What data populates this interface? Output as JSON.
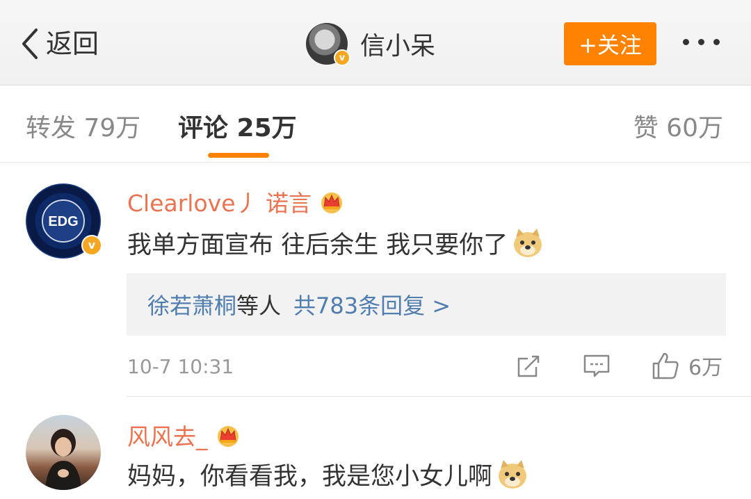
{
  "header": {
    "back_label": "返回",
    "title": "信小呆",
    "follow_label": "+关注"
  },
  "tabs": {
    "forward": "转发 79万",
    "comment": "评论 25万",
    "like": "赞 60万"
  },
  "comments": [
    {
      "username": "Clearlove丿 诺言",
      "avatar_text": "EDG",
      "text": "我单方面宣布 往后余生 我只要你了",
      "replies": {
        "name": "徐若萧桐",
        "middle": "等人",
        "count": "共783条回复 >"
      },
      "time": "10-7 10:31",
      "like_count": "6万"
    },
    {
      "username": "风风去_",
      "text": "妈妈，你看看我，我是您小女儿啊"
    }
  ],
  "colors": {
    "accent": "#ff8200",
    "username": "#eb7350",
    "link": "#507daf"
  }
}
